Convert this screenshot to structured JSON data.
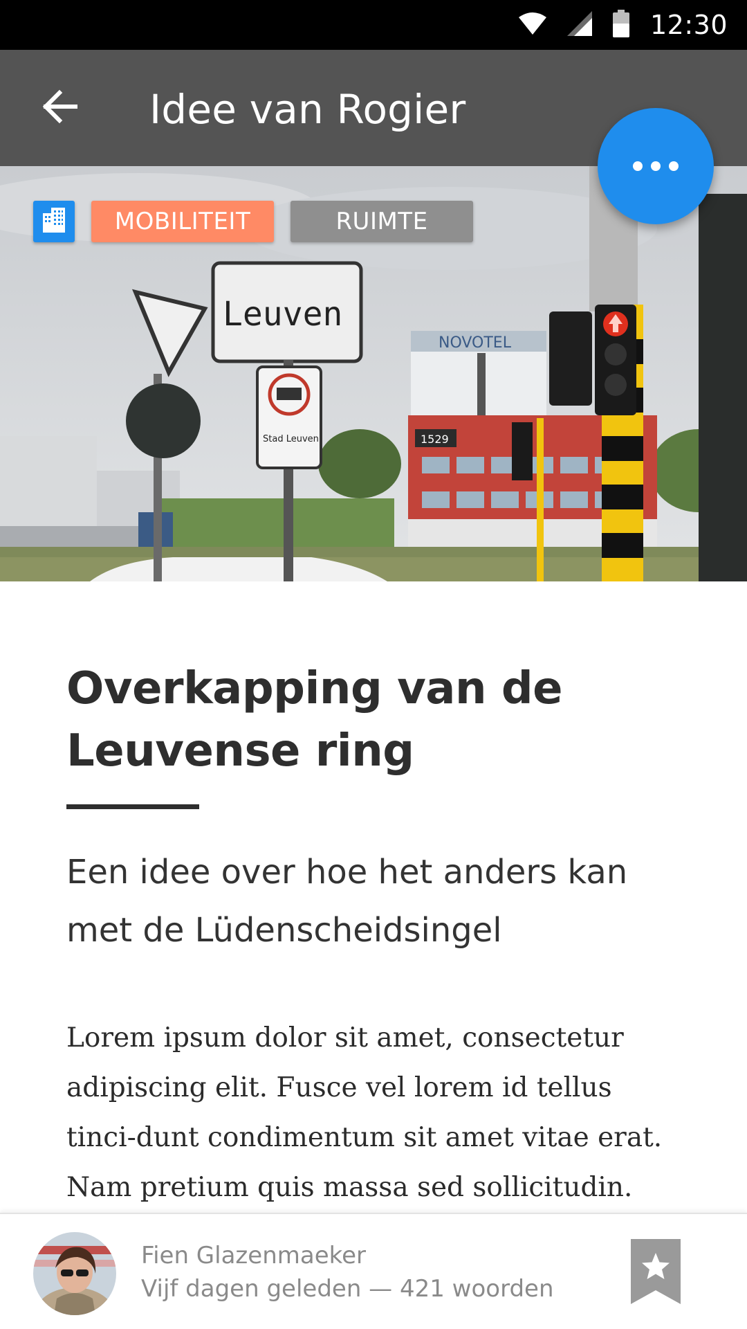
{
  "status_bar": {
    "time": "12:30",
    "icons": [
      "wifi-icon",
      "cell-signal-icon",
      "battery-icon"
    ]
  },
  "app_bar": {
    "title": "Idee van Rogier",
    "back_icon": "arrow-back-icon",
    "background": "#545454"
  },
  "fab": {
    "icon": "more-horizontal-icon",
    "color": "#1f8ded"
  },
  "hero": {
    "category_icon": "city-buildings-icon",
    "tags": [
      {
        "label": "MOBILITEIT",
        "color": "#ff8a65"
      },
      {
        "label": "RUIMTE",
        "color": "#8f8f8f"
      }
    ],
    "photo": {
      "sign_text": "Leuven",
      "hotel_sign": "NOVOTEL",
      "building_number": "1529",
      "camera_sign_text": "Stad Leuven"
    }
  },
  "article": {
    "title": "Overkapping van de Leuvense ring",
    "subtitle": "Een idee over hoe het anders kan met de Lüdenscheidsingel",
    "body": "Lorem ipsum dolor sit amet, consectetur adipiscing elit. Fusce vel lorem id tellus tinci-dunt condimentum sit amet vitae erat. Nam pretium quis massa sed sollicitudin. Aenean"
  },
  "author": {
    "name": "Fien Glazenmaeker",
    "meta": "Vijf dagen geleden — 421 woorden",
    "bookmark_icon": "star-bookmark-icon"
  }
}
